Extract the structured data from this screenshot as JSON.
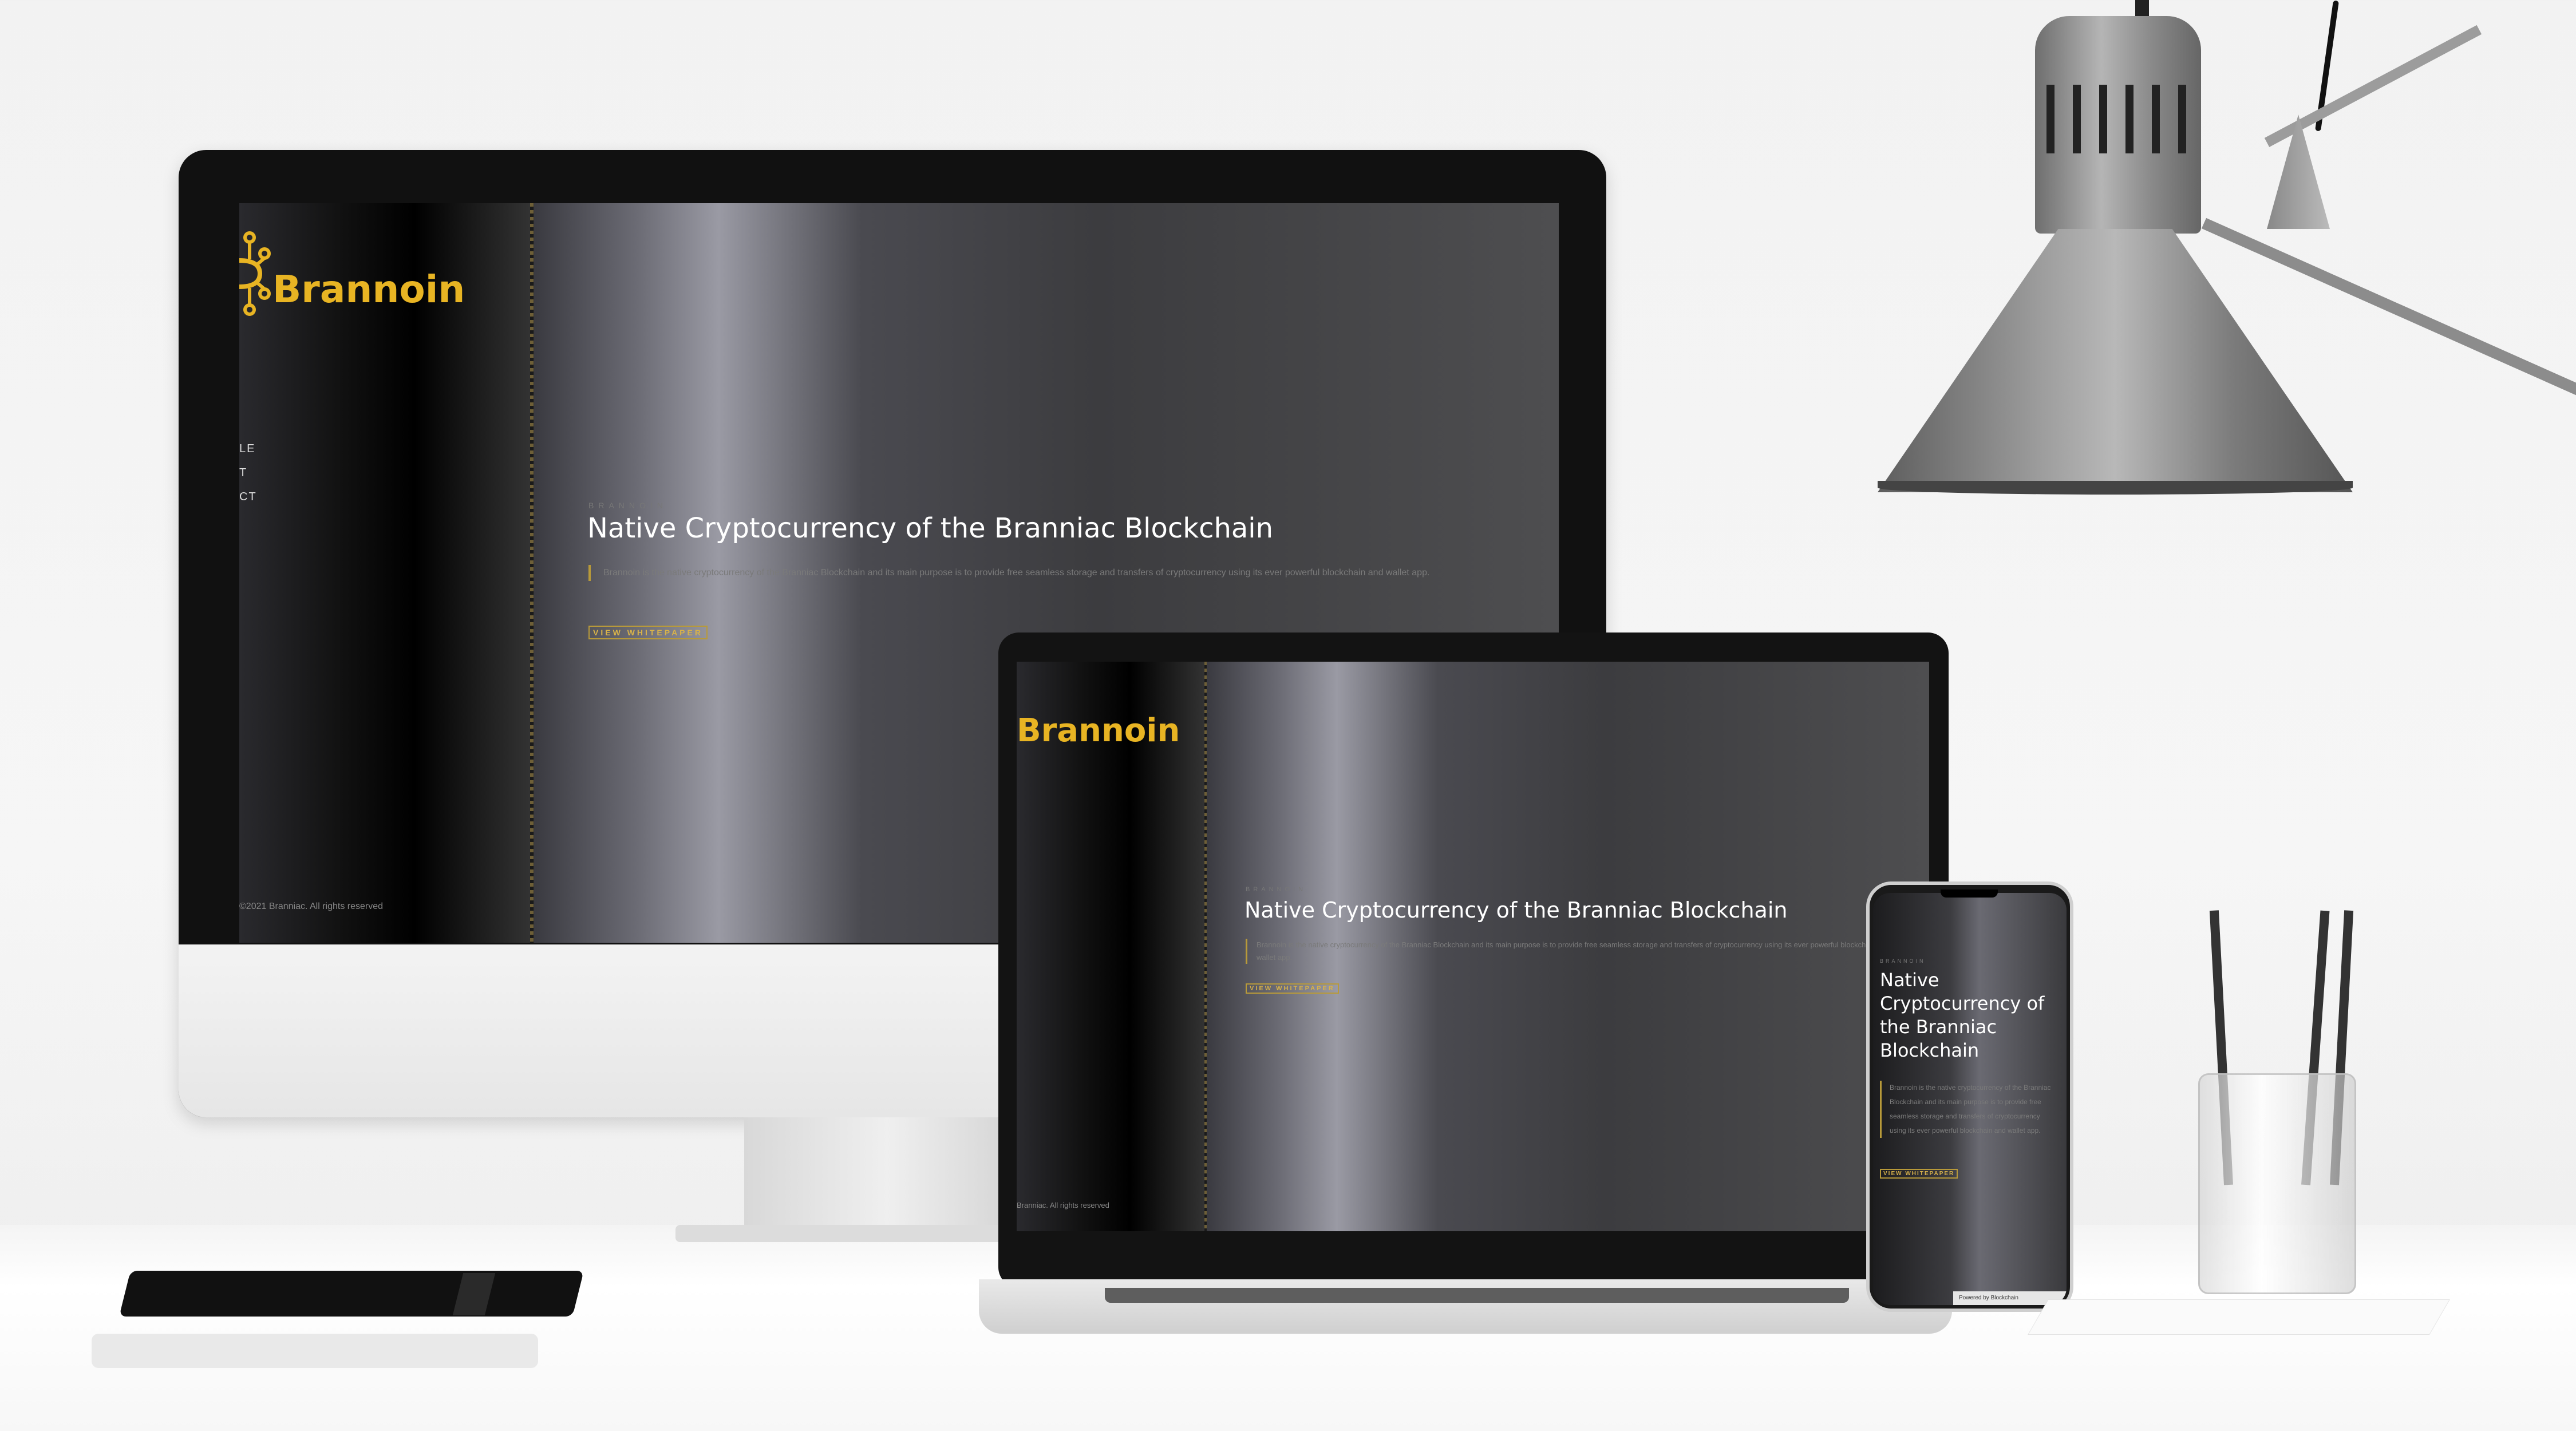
{
  "site": {
    "brand": "Brannoin",
    "nav": [
      "LE",
      "T",
      "CT"
    ],
    "copyright": "©2021 Branniac. All rights reserved",
    "copyright_short": "Branniac. All rights reserved",
    "eyebrow": "BRANNOIN",
    "headline": "Native Cryptocurrency of the Branniac Blockchain",
    "description": "Brannoin is the native cryptocurrency of the Branniac Blockchain and its main purpose is to provide free seamless storage and transfers of cryptocurrency using its ever powerful blockchain and wallet app.",
    "cta": "VIEW WHITEPAPER"
  },
  "phone": {
    "headline_lines": [
      "Native",
      "Cryptocurrency of",
      "the Branniac",
      "Blockchain"
    ],
    "powered_by": "Powered by  Blockchain"
  },
  "colors": {
    "accent": "#e8b423",
    "background": "#333333",
    "text": "#ffffff"
  }
}
